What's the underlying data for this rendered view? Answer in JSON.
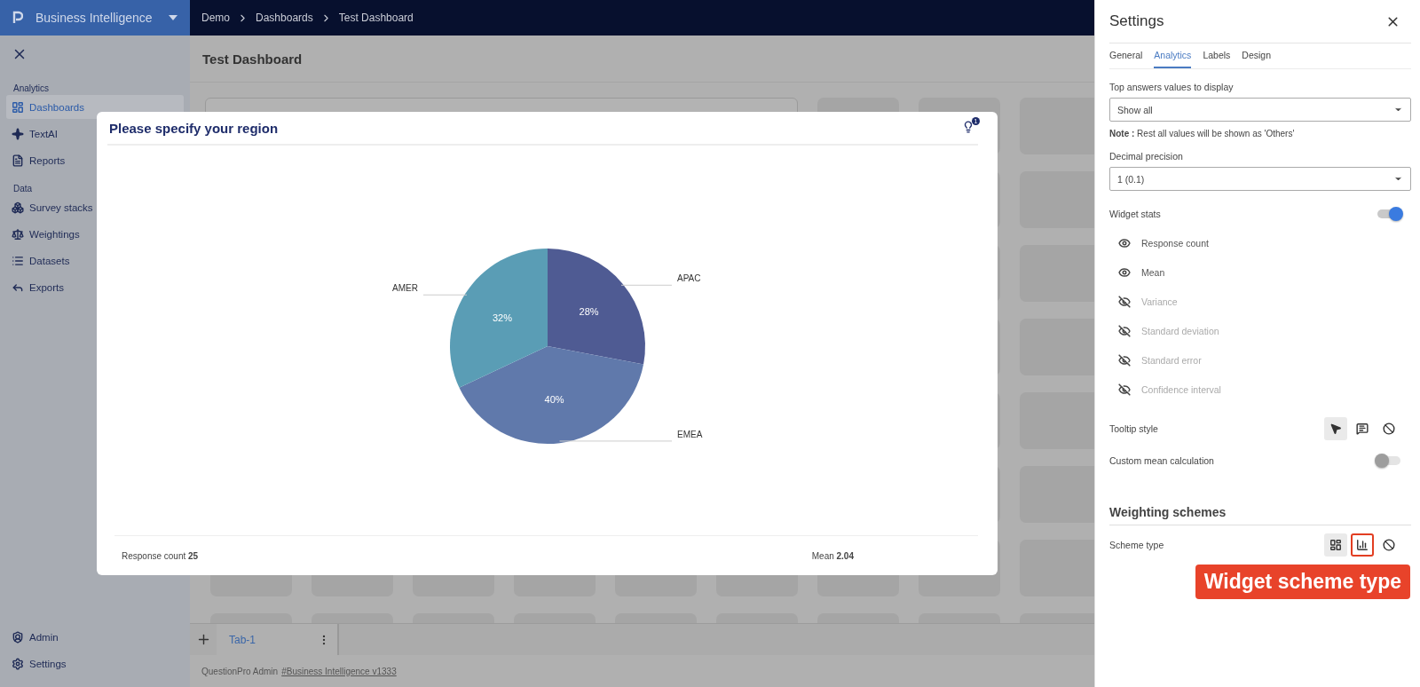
{
  "app": {
    "title": "Business Intelligence"
  },
  "breadcrumb": [
    "Demo",
    "Dashboards",
    "Test Dashboard"
  ],
  "sidebar": {
    "sections": [
      {
        "heading": "Analytics",
        "items": [
          {
            "label": "Dashboards",
            "selected": true
          },
          {
            "label": "TextAI",
            "selected": false
          },
          {
            "label": "Reports",
            "selected": false
          }
        ]
      },
      {
        "heading": "Data",
        "items": [
          {
            "label": "Survey stacks",
            "selected": false
          },
          {
            "label": "Weightings",
            "selected": false
          },
          {
            "label": "Datasets",
            "selected": false
          },
          {
            "label": "Exports",
            "selected": false
          }
        ]
      }
    ],
    "bottom_items": [
      {
        "label": "Admin"
      },
      {
        "label": "Settings"
      }
    ]
  },
  "page": {
    "title": "Test Dashboard"
  },
  "dashboard_tabs": [
    {
      "label": "Tab-1",
      "selected": true
    }
  ],
  "footer": {
    "text": "QuestionPro Admin",
    "link": "#Business Intelligence v1333"
  },
  "widget": {
    "title": "Please specify your region",
    "badge": "1",
    "chart_data": {
      "type": "pie",
      "categories": [
        "APAC",
        "EMEA",
        "AMER"
      ],
      "values": [
        28,
        40,
        32
      ],
      "value_labels": [
        "28%",
        "40%",
        "32%"
      ]
    },
    "stats": [
      "Response count **25**",
      "Mean **2.04**"
    ]
  },
  "settings": {
    "title": "Settings",
    "tabs": [
      {
        "label": "General",
        "selected": false
      },
      {
        "label": "Analytics",
        "selected": true
      },
      {
        "label": "Labels",
        "selected": false
      },
      {
        "label": "Design",
        "selected": false
      }
    ],
    "top_answers": {
      "label": "Top answers values to display",
      "value": "Show all"
    },
    "note": "**Note :** Rest all values will be shown as 'Others'",
    "decimal_precision": {
      "label": "Decimal precision",
      "value": "1 (0.1)"
    },
    "widget_stats": {
      "label": "Widget stats",
      "on": true
    },
    "stats": [
      {
        "label": "Response count",
        "visible": true
      },
      {
        "label": "Mean",
        "visible": true
      },
      {
        "label": "Variance",
        "visible": false
      },
      {
        "label": "Standard deviation",
        "visible": false
      },
      {
        "label": "Standard error",
        "visible": false
      },
      {
        "label": "Confidence interval",
        "visible": false
      }
    ],
    "tooltip_style": {
      "label": "Tooltip style",
      "options": [
        {
          "kind": "pointer",
          "selected": true,
          "highlighted": false
        },
        {
          "kind": "comment",
          "selected": false,
          "highlighted": false
        },
        {
          "kind": "none",
          "selected": false,
          "highlighted": false
        }
      ]
    },
    "custom_mean": {
      "label": "Custom mean calculation",
      "on": false
    },
    "weighting": {
      "heading": "Weighting schemes",
      "label": "Scheme type",
      "options": [
        {
          "kind": "grid",
          "selected": true,
          "highlighted": false
        },
        {
          "kind": "chart",
          "selected": false,
          "highlighted": true
        },
        {
          "kind": "none",
          "selected": false,
          "highlighted": false
        }
      ]
    },
    "callout": "Widget scheme type"
  }
}
